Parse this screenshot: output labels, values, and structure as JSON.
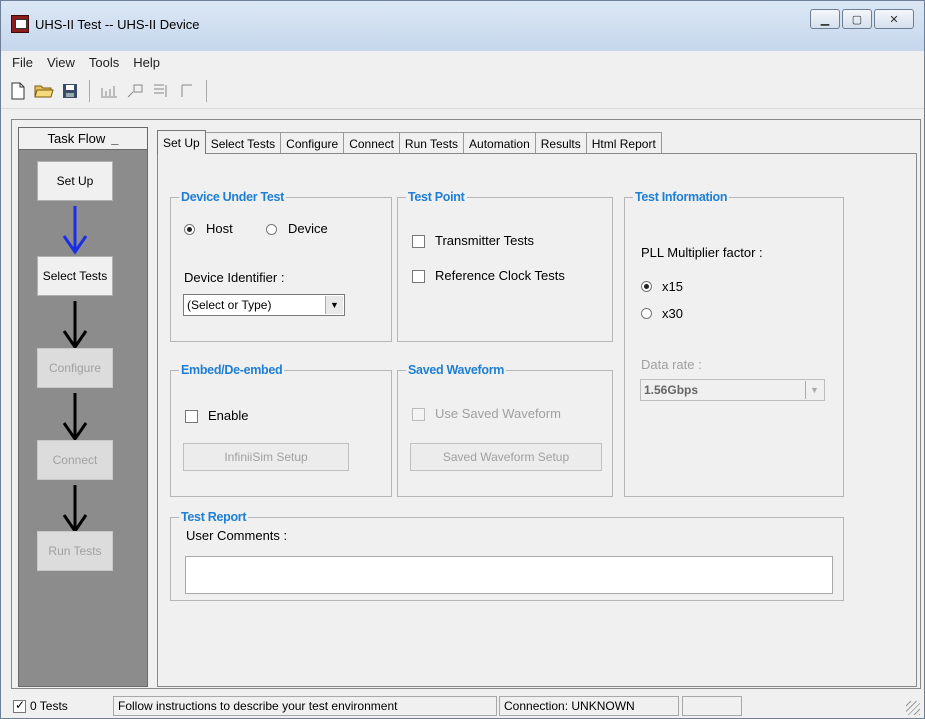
{
  "window": {
    "title": "UHS-II Test -- UHS-II Device"
  },
  "menu": [
    "File",
    "View",
    "Tools",
    "Help"
  ],
  "toolbar": {
    "icons": [
      "new-file-icon",
      "open-folder-icon",
      "save-icon",
      "chart-icon",
      "run-icon",
      "step-icon",
      "stop-icon"
    ]
  },
  "taskflow": {
    "header": "Task Flow",
    "minimize": "_",
    "steps": [
      "Set Up",
      "Select Tests",
      "Configure",
      "Connect",
      "Run Tests"
    ]
  },
  "tabs": [
    "Set Up",
    "Select Tests",
    "Configure",
    "Connect",
    "Run Tests",
    "Automation",
    "Results",
    "Html Report"
  ],
  "dut": {
    "title": "Device Under Test",
    "host": "Host",
    "device": "Device",
    "identifier_label": "Device Identifier :",
    "identifier_value": "(Select or Type)"
  },
  "test_point": {
    "title": "Test Point",
    "transmitter": "Transmitter Tests",
    "refclock": "Reference Clock Tests"
  },
  "test_info": {
    "title": "Test Information",
    "pll_label": "PLL Multiplier factor :",
    "x15": "x15",
    "x30": "x30",
    "datarate_label": "Data rate :",
    "datarate_value": "1.56Gbps"
  },
  "embed": {
    "title": "Embed/De-embed",
    "enable": "Enable",
    "setup_button": "InfiniiSim Setup"
  },
  "saved_waveform": {
    "title": "Saved Waveform",
    "use_label": "Use Saved Waveform",
    "setup_button": "Saved Waveform Setup"
  },
  "test_report": {
    "title": "Test Report",
    "comments_label": "User Comments :",
    "comments_value": ""
  },
  "status": {
    "tests": "0 Tests",
    "message": "Follow instructions to describe your test environment",
    "connection": "Connection: UNKNOWN"
  },
  "colors": {
    "group_title": "#1f7fd4",
    "flow_arrow_active": "#1a2ee8",
    "flow_arrow": "#000000",
    "taskflow_bg": "#8c8c8c"
  }
}
